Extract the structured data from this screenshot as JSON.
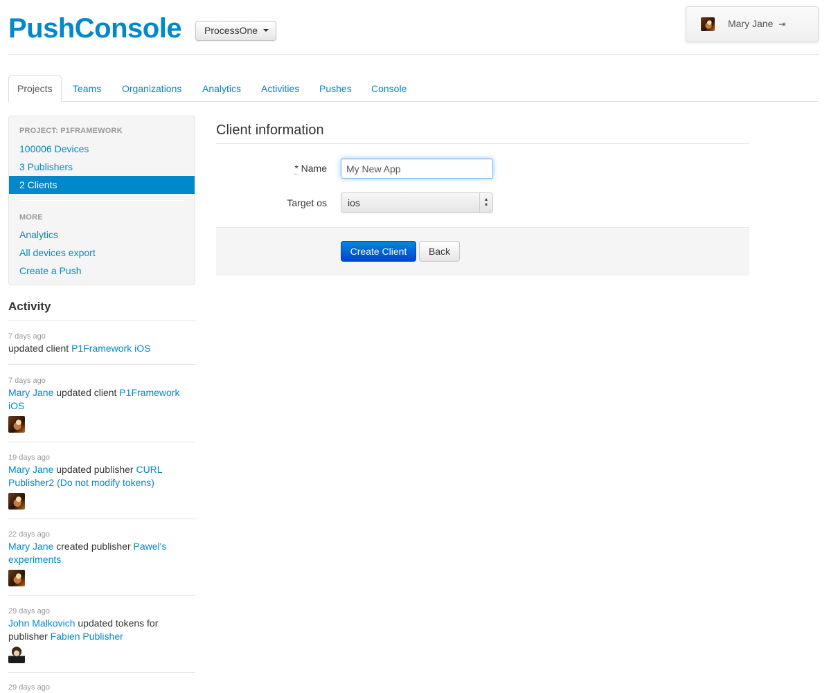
{
  "header": {
    "brand": "PushConsole",
    "org_selector": "ProcessOne",
    "user_name": "Mary Jane",
    "logout_glyph": "⇥"
  },
  "tabs": [
    "Projects",
    "Teams",
    "Organizations",
    "Analytics",
    "Activities",
    "Pushes",
    "Console"
  ],
  "active_tab": "Projects",
  "sidebar": {
    "project_header": "PROJECT: P1FRAMEWORK",
    "items": [
      "100006 Devices",
      "3 Publishers",
      "2 Clients"
    ],
    "more_header": "MORE",
    "more_items": [
      "Analytics",
      "All devices export",
      "Create a Push"
    ]
  },
  "activity": {
    "title": "Activity",
    "entries": [
      {
        "time": "7 days ago",
        "actor": "",
        "action": "updated client ",
        "target": "P1Framework iOS"
      },
      {
        "time": "7 days ago",
        "actor": "Mary Jane",
        "action": " updated client ",
        "target": "P1Framework iOS"
      },
      {
        "time": "19 days ago",
        "actor": "Mary Jane",
        "action": " updated publisher ",
        "target": "CURL Publisher2 (Do not modify tokens)"
      },
      {
        "time": "22 days ago",
        "actor": "Mary Jane",
        "action": " created publisher ",
        "target": "Pawel's experiments"
      },
      {
        "time": "29 days ago",
        "actor": "John Malkovich",
        "action": " updated tokens for publisher ",
        "target": "Fabien Publisher"
      },
      {
        "time": "29 days ago"
      }
    ]
  },
  "form": {
    "legend": "Client information",
    "name_required_mark": "*",
    "name_label": " Name",
    "name_value": "My New App",
    "target_os_label": "Target os",
    "target_os_value": "ios",
    "submit_label": "Create Client",
    "back_label": "Back"
  },
  "colors": {
    "link": "#0088cc",
    "primary_button": "#0055cc",
    "active_nav": "#0088cc"
  }
}
